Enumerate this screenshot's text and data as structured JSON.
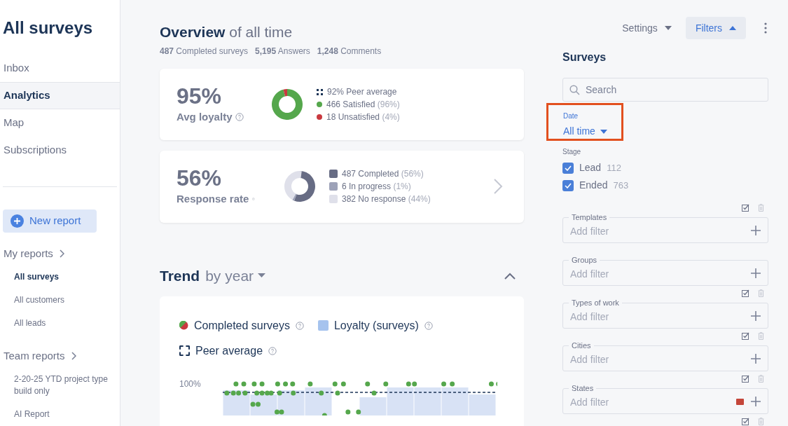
{
  "page_title": "All surveys",
  "nav": [
    {
      "label": "Inbox",
      "selected": false
    },
    {
      "label": "Analytics",
      "selected": true
    },
    {
      "label": "Map",
      "selected": false
    },
    {
      "label": "Subscriptions",
      "selected": false
    }
  ],
  "new_report_button": "New report",
  "report_groups": [
    {
      "label": "My reports",
      "items": [
        {
          "label": "All surveys",
          "selected": true
        },
        {
          "label": "All customers",
          "selected": false
        },
        {
          "label": "All leads",
          "selected": false
        }
      ]
    },
    {
      "label": "Team reports",
      "items": [
        {
          "label": "2-20-25 YTD project type build only",
          "selected": false
        },
        {
          "label": "AI Report",
          "selected": false
        }
      ]
    }
  ],
  "overview": {
    "title": "Overview",
    "subtitle": "of all time",
    "stats": [
      "**487** Completed surveys",
      "**5,195** Answers",
      "**1,248** Comments"
    ]
  },
  "cards": [
    {
      "value": "95%",
      "label": "Avg loyalty",
      "legend": [
        {
          "kind": "peer",
          "text": "92% Peer average"
        },
        {
          "kind": "dot",
          "color": "#55a74c",
          "text": "466 Satisfied",
          "pct": "(96%)"
        },
        {
          "kind": "dot",
          "color": "#c9393f",
          "text": "18 Unsatisfied",
          "pct": "(4%)"
        }
      ],
      "chevron": false
    },
    {
      "value": "56%",
      "label": "Response rate",
      "legend": [
        {
          "kind": "square",
          "color": "#676c84",
          "text": "487 Completed",
          "pct": "(56%)"
        },
        {
          "kind": "square",
          "color": "#9da2b8",
          "text": "6 In progress",
          "pct": "(1%)"
        },
        {
          "kind": "square",
          "color": "#dfe0ea",
          "text": "382 No response",
          "pct": "(44%)"
        }
      ],
      "chevron": true
    }
  ],
  "trend": {
    "title": "Trend",
    "subtitle": "by year",
    "expanded": true,
    "legend": [
      {
        "kind": "split-dot",
        "text": "Completed surveys"
      },
      {
        "kind": "square",
        "text": "Loyalty (surveys)"
      },
      {
        "kind": "dashed",
        "text": "Peer average"
      }
    ],
    "axis_label": "100%"
  },
  "toolbar": {
    "settings": "Settings",
    "filters": "Filters"
  },
  "filters": {
    "title": "Surveys",
    "search_placeholder": "Search",
    "date": {
      "label": "Date",
      "value": "All time",
      "highlighted": true
    },
    "stage": {
      "label": "Stage",
      "options": [
        {
          "label": "Lead",
          "count": "112",
          "checked": true
        },
        {
          "label": "Ended",
          "count": "763",
          "checked": true
        }
      ]
    },
    "groups": [
      {
        "label": "Templates",
        "placeholder": "Add filter",
        "actions": true,
        "badge": false
      },
      {
        "label": "Groups",
        "placeholder": "Add filter",
        "actions": false,
        "badge": false
      },
      {
        "label": "Types of work",
        "placeholder": "Add filter",
        "actions": true,
        "badge": false
      },
      {
        "label": "Cities",
        "placeholder": "Add filter",
        "actions": true,
        "badge": false
      },
      {
        "label": "States",
        "placeholder": "Add filter",
        "actions": true,
        "badge": true
      },
      {
        "actions": true,
        "badge": false
      }
    ]
  }
}
